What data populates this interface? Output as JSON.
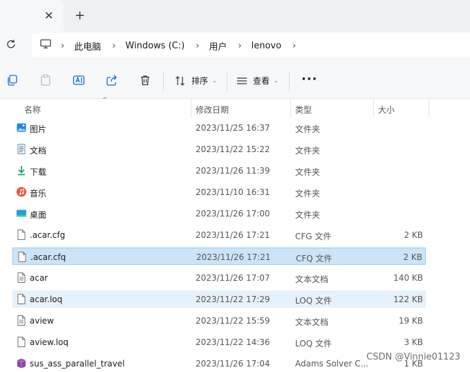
{
  "tab": {
    "close": "✕",
    "new": "+"
  },
  "breadcrumb": [
    "此电脑",
    "Windows (C:)",
    "用户",
    "lenovo"
  ],
  "toolbar": {
    "sort_label": "排序",
    "view_label": "查看",
    "more": "···"
  },
  "columns": {
    "name": "名称",
    "modified": "修改日期",
    "type": "类型",
    "size": "大小"
  },
  "files": [
    {
      "name": "图片",
      "modified": "2023/11/25 16:37",
      "type": "文件夹",
      "size": "",
      "icon": "pictures-folder-icon"
    },
    {
      "name": "文档",
      "modified": "2023/11/22 15:22",
      "type": "文件夹",
      "size": "",
      "icon": "documents-folder-icon"
    },
    {
      "name": "下载",
      "modified": "2023/11/26 11:39",
      "type": "文件夹",
      "size": "",
      "icon": "downloads-folder-icon"
    },
    {
      "name": "音乐",
      "modified": "2023/11/10 16:31",
      "type": "文件夹",
      "size": "",
      "icon": "music-folder-icon"
    },
    {
      "name": "桌面",
      "modified": "2023/11/26 17:00",
      "type": "文件夹",
      "size": "",
      "icon": "desktop-folder-icon"
    },
    {
      "name": ".acar.cfg",
      "modified": "2023/11/26 17:21",
      "type": "CFG 文件",
      "size": "2 KB",
      "icon": "file-icon"
    },
    {
      "name": ".acar.cfq",
      "modified": "2023/11/26 17:21",
      "type": "CFQ 文件",
      "size": "2 KB",
      "icon": "file-icon",
      "state": "selected"
    },
    {
      "name": "acar",
      "modified": "2023/11/26 17:07",
      "type": "文本文档",
      "size": "140 KB",
      "icon": "text-file-icon"
    },
    {
      "name": "acar.loq",
      "modified": "2023/11/22 17:29",
      "type": "LOQ 文件",
      "size": "122 KB",
      "icon": "file-icon",
      "state": "hover"
    },
    {
      "name": "aview",
      "modified": "2023/11/22 15:59",
      "type": "文本文档",
      "size": "19 KB",
      "icon": "text-file-icon"
    },
    {
      "name": "aview.loq",
      "modified": "2023/11/22 14:36",
      "type": "LOQ 文件",
      "size": "3 KB",
      "icon": "file-icon"
    },
    {
      "name": "sus_ass_parallel_travel",
      "modified": "2023/11/26 17:04",
      "type": "Adams Solver C...",
      "size": "1 KB",
      "icon": "adams-file-icon"
    }
  ],
  "watermark": "CSDN @Vinnie01123",
  "colors": {
    "selected_bg": "#cce4f7",
    "hover_bg": "#e5f1fb",
    "accent": "#0078d4"
  }
}
